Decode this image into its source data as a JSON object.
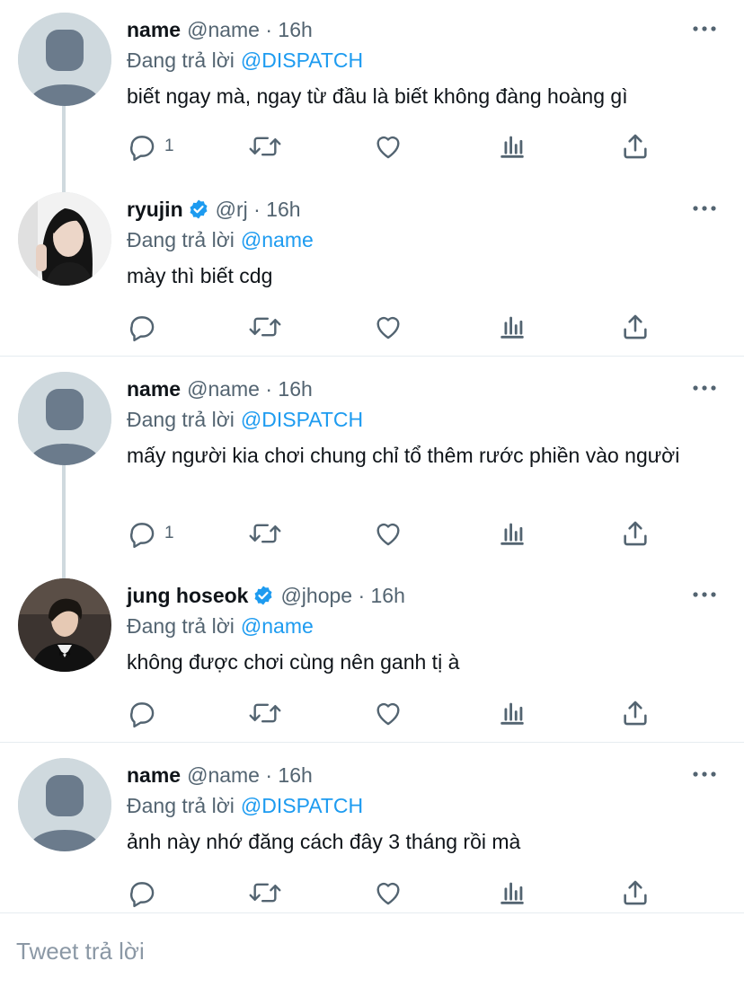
{
  "colors": {
    "link": "#1d9bf0",
    "meta": "#536471",
    "icon": "#536471",
    "verified": "#1d9bf0",
    "placeholder_avatar": "#cfd9de",
    "placeholder_figure": "#6b7b8c"
  },
  "icons": {
    "reply": "reply-icon",
    "retweet": "retweet-icon",
    "like": "heart-icon",
    "views": "views-icon",
    "share": "share-icon",
    "more": "more-dots-icon",
    "verified": "verified-badge-icon"
  },
  "replying_label": "Đang trả lời",
  "tweets": [
    {
      "name": "name",
      "meta": "@name · 16h",
      "verified": false,
      "replying_to": "@DISPATCH",
      "text": "biết ngay mà, ngay từ đầu là biết không đàng hoàng gì",
      "reply_count": "1"
    },
    {
      "name": "ryujin",
      "meta": "@rj · 16h",
      "verified": true,
      "replying_to": "@name",
      "text": "mày thì biết cdg",
      "reply_count": ""
    },
    {
      "name": "name",
      "meta": "@name · 16h",
      "verified": false,
      "replying_to": "@DISPATCH",
      "text": "mấy người kia chơi chung chỉ tổ thêm rước phiền vào người",
      "reply_count": "1"
    },
    {
      "name": "jung hoseok",
      "meta": "@jhope · 16h",
      "verified": true,
      "replying_to": "@name",
      "text": "không được chơi cùng nên ganh tị à",
      "reply_count": ""
    },
    {
      "name": "name",
      "meta": "@name · 16h",
      "verified": false,
      "replying_to": "@DISPATCH",
      "text": "ảnh này nhớ đăng cách đây 3 tháng rồi mà",
      "reply_count": ""
    }
  ],
  "compose": {
    "placeholder": "Tweet trả lời"
  }
}
